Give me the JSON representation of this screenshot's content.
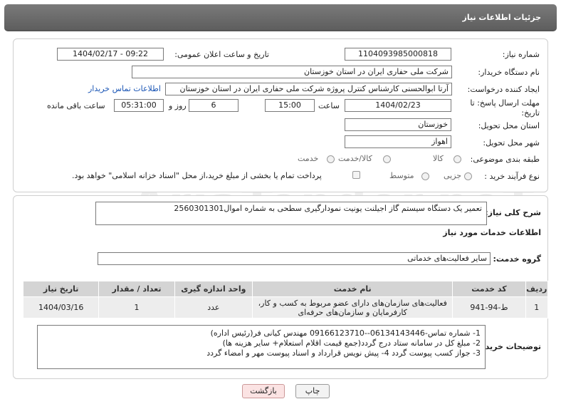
{
  "header": {
    "title": "جزئیات اطلاعات نیاز"
  },
  "form": {
    "need_number_label": "شماره نیاز:",
    "need_number_value": "1104093985000818",
    "announce_date_label": "تاریخ و ساعت اعلان عمومی:",
    "announce_date_value": "1404/02/17 - 09:22",
    "buyer_org_label": "نام دستگاه خریدار:",
    "buyer_org_value": "شرکت ملی حفاری ایران در استان خوزستان",
    "requester_label": "ایجاد کننده درخواست:",
    "requester_value": "آرتا ابوالحسنی کارشناس کنترل پروژه شرکت ملی حفاری ایران در استان خوزستان",
    "contact_link": "اطلاعات تماس خریدار",
    "deadline_label_1": "مهلت ارسال پاسخ: تا",
    "deadline_label_2": "تاریخ:",
    "deadline_date": "1404/02/23",
    "time_label": "ساعت",
    "deadline_time": "15:00",
    "days_value": "6",
    "days_label": "روز و",
    "remaining_time": "05:31:00",
    "remaining_label": "ساعت باقی مانده",
    "province_label": "استان محل تحویل:",
    "province_value": "خوزستان",
    "city_label": "شهر محل تحویل:",
    "city_value": "اهواز",
    "category_label": "طبقه بندی موضوعی:",
    "category_options": [
      "کالا",
      "کالا/خدمت",
      "خدمت"
    ],
    "process_label": "نوع فرآیند خرید :",
    "process_options": [
      "جزیی",
      "متوسط"
    ],
    "payment_note": "پرداخت تمام یا بخشی از مبلغ خرید،از محل \"اسناد خزانه اسلامی\" خواهد بود."
  },
  "description": {
    "label": "شرح کلی نیاز:",
    "value": "تعمیر یک دستگاه سیستم گاز اجیلنت یونیت نمودارگیری سطحی به شماره اموال2560301301"
  },
  "services": {
    "section_title": "اطلاعات خدمات مورد نیاز",
    "group_label": "گروه خدمت:",
    "group_value": "سایر فعالیت‌های خدماتی",
    "columns": [
      "ردیف",
      "کد خدمت",
      "نام خدمت",
      "واحد اندازه گیری",
      "تعداد / مقدار",
      "تاریخ نیاز"
    ],
    "rows": [
      {
        "row": "1",
        "code": "ط-94-941",
        "name_line1": "فعالیت‌های سازمان‌های دارای عضو مربوط به کسب و کار،",
        "name_line2": "کارفرمایان و سازمان‌های حرفه‌ای",
        "unit": "عدد",
        "qty": "1",
        "date": "1404/03/16"
      }
    ]
  },
  "buyer_notes": {
    "label": "توضیحات خریدار:",
    "line1": "1- شماره تماس-06134143446--09166123710 مهندس کیانی فر(رئیس اداره)",
    "line2": "2- مبلغ کل در سامانه ستاد درج گردد(جمع  قیمت اقلام استعلام+ سایر هزینه ها)",
    "line3": "3- جواز کسب  پیوست گردد 4- پیش نویس قرارداد و اسناد پیوست مهر و امضاء گردد"
  },
  "buttons": {
    "print": "چاپ",
    "back": "بازگشت"
  },
  "watermark": "AriaTender.neT"
}
